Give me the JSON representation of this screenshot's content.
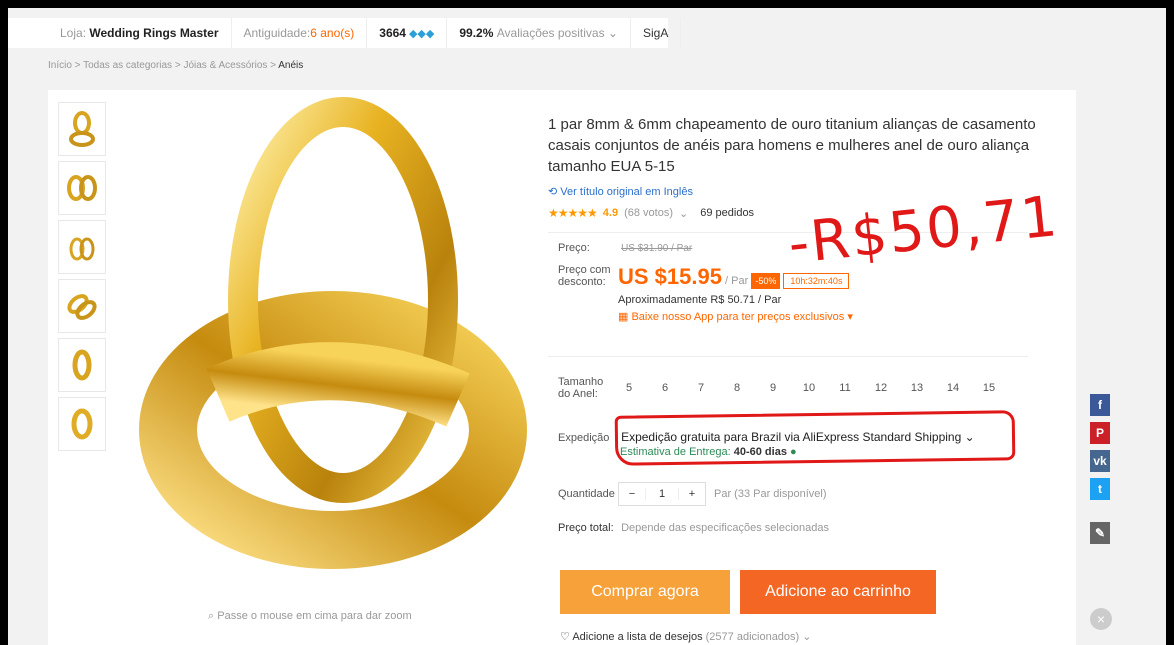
{
  "store": {
    "label": "Loja:",
    "name": "Wedding Rings Master",
    "seniority_label": "Antiguidade:",
    "seniority": "6 ano(s)",
    "score": "3664",
    "positive": "99.2%",
    "positive_label": "Avaliações positivas",
    "follow": "SigA"
  },
  "breadcrumb": {
    "path": "Início > Todas as categorias > Jóias & Acessórios > ",
    "current": "Anéis"
  },
  "product": {
    "title": "1 par 8mm & 6mm chapeamento de ouro titanium alianças de casamento casais conjuntos de anéis para homens e mulheres anel de ouro aliança tamanho EUA 5-15",
    "translate_link": "Ver título original em Inglês",
    "stars": "★★★★★",
    "score": "4.9",
    "votes": "(68 votos)",
    "orders": "69 pedidos",
    "price_label": "Preço:",
    "old_price": "US $31.90 / Par",
    "discount_label_1": "Preço com",
    "discount_label_2": "desconto:",
    "price": "US $15.95",
    "unit": "/ Par",
    "off": "-50%",
    "timer": "10h:32m:40s",
    "approx": "Aproximadamente R$ 50.71 / Par",
    "app_promo": "Baixe nosso App para ter preços exclusivos",
    "size_label_1": "Tamanho",
    "size_label_2": "do Anel:",
    "sizes": [
      "5",
      "6",
      "7",
      "8",
      "9",
      "10",
      "11",
      "12",
      "13",
      "14",
      "15"
    ],
    "shipping_label": "Expedição",
    "shipping": "Expedição gratuita para Brazil via AliExpress Standard Shipping",
    "eta_label": "Estimativa de Entrega:",
    "eta": "40-60 dias",
    "qty_label": "Quantidade",
    "qty_minus": "−",
    "qty": "1",
    "qty_plus": "+",
    "qty_avail": "Par (33 Par disponível)",
    "total_label": "Preço total:",
    "total": "Depende das especificações selecionadas",
    "buy": "Comprar agora",
    "cart": "Adicione ao carrinho",
    "wishlist": "Adicione a lista de desejos",
    "wishlist_count": "(2577 adicionados)",
    "zoom_hint": "Passe o mouse em cima para dar zoom"
  },
  "annotation": {
    "handwritten_price": "-R$50,71"
  },
  "colors": {
    "accent": "#ff6600",
    "buy_button": "#f7a13a",
    "cart_button": "#f46623",
    "annotation_red": "#e01818"
  }
}
